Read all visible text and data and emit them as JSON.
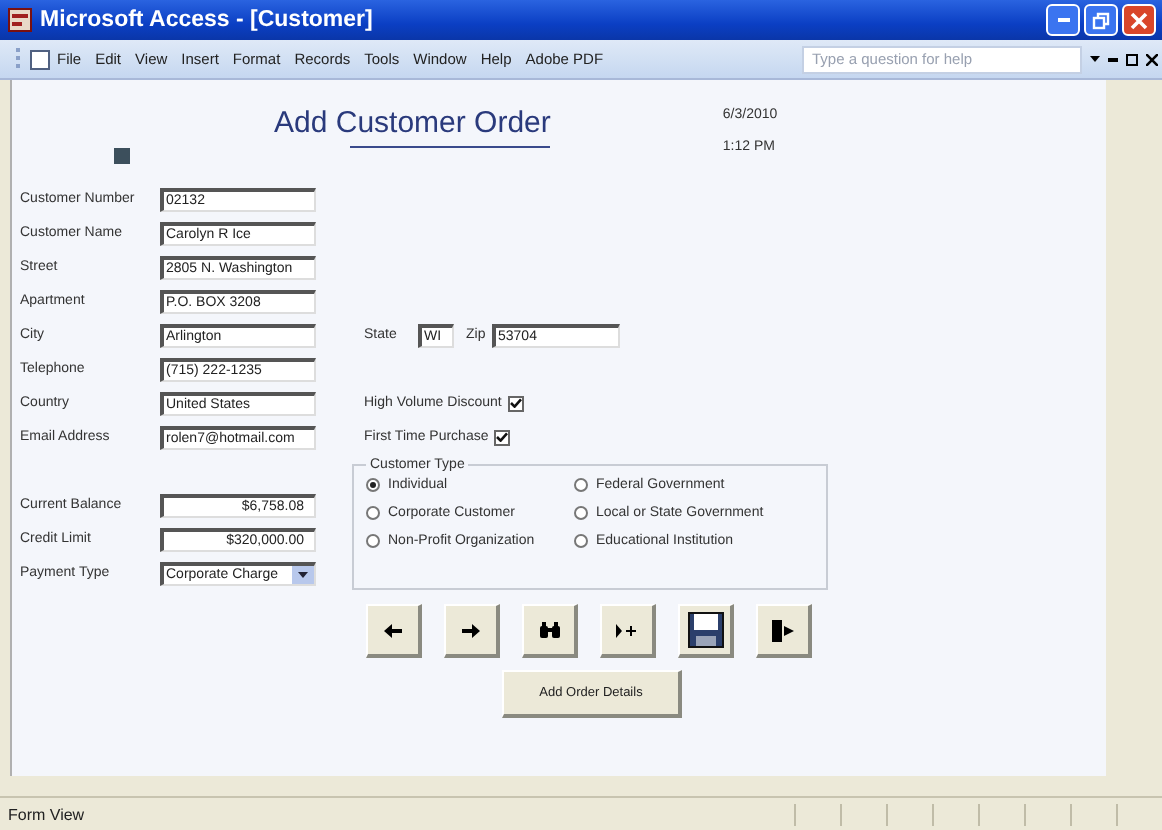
{
  "window": {
    "title": "Microsoft Access - [Customer]"
  },
  "menu": [
    "File",
    "Edit",
    "View",
    "Insert",
    "Format",
    "Records",
    "Tools",
    "Window",
    "Help",
    "Adobe PDF"
  ],
  "help_box": {
    "placeholder": "Type a question for help"
  },
  "form": {
    "title": "Add Customer Order",
    "date": "6/3/2010",
    "time": "1:12 PM",
    "fields": [
      {
        "label": "Customer Number",
        "value": "02132"
      },
      {
        "label": "Customer Name",
        "value": "Carolyn R Ice"
      },
      {
        "label": "Street",
        "value": "2805 N. Washington"
      },
      {
        "label": "Apartment",
        "value": "P.O. BOX 3208"
      },
      {
        "label": "City",
        "value": "Arlington"
      },
      {
        "label": "Telephone",
        "value": "(715) 222-1235"
      },
      {
        "label": "Country",
        "value": "United States"
      },
      {
        "label": "Email Address",
        "value": "rolen7@hotmail.com"
      }
    ],
    "address": {
      "state_label": "State",
      "state": "WI",
      "zip_label": "Zip",
      "zip": "53704"
    },
    "checkboxes": [
      {
        "label": "High Volume Discount",
        "checked": true
      },
      {
        "label": "First Time Purchase",
        "checked": true
      }
    ],
    "billing_fields": [
      {
        "label": "Current Balance",
        "value": "$6,758.08",
        "kind": "currency"
      },
      {
        "label": "Credit Limit",
        "value": "$320,000.00",
        "kind": "currency"
      },
      {
        "label": "Payment Type",
        "value": "Corporate Charge",
        "kind": "dropdown"
      }
    ],
    "customer_type": {
      "legend": "Customer Type",
      "options": [
        {
          "label": "Individual",
          "selected": true
        },
        {
          "label": "Federal Government",
          "selected": false
        },
        {
          "label": "Corporate Customer",
          "selected": false
        },
        {
          "label": "Local or State Government",
          "selected": false
        },
        {
          "label": "Non-Profit Organization",
          "selected": false
        },
        {
          "label": "Educational Institution",
          "selected": false
        }
      ]
    },
    "nav_buttons": [
      {
        "kind": "previous"
      },
      {
        "kind": "next"
      },
      {
        "kind": "find"
      },
      {
        "kind": "new"
      },
      {
        "kind": "save"
      },
      {
        "kind": "exit"
      }
    ],
    "action_button": "Add Order Details"
  },
  "status_bar": {
    "text": "Form View"
  }
}
